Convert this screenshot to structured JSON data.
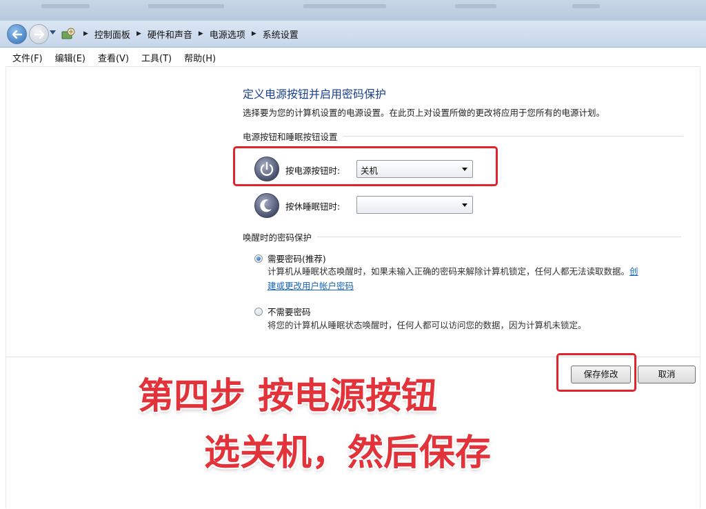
{
  "breadcrumb": [
    "控制面板",
    "硬件和声音",
    "电源选项",
    "系统设置"
  ],
  "menu": [
    "文件(F)",
    "编辑(E)",
    "查看(V)",
    "工具(T)",
    "帮助(H)"
  ],
  "page": {
    "title": "定义电源按钮并启用密码保护",
    "description": "选择要为您的计算机设置的电源设置。在此页上对设置所做的更改将应用于您所有的电源计划。"
  },
  "power_section": {
    "heading": "电源按钮和睡眠按钮设置",
    "power_button_label": "按电源按钮时:",
    "power_button_value": "关机",
    "sleep_button_label": "按休睡眠钮时:",
    "sleep_button_value": ""
  },
  "password_section": {
    "heading": "唤醒时的密码保护",
    "require_label": "需要密码(推荐)",
    "require_selected": true,
    "require_desc_1": "计算机从睡眠状态唤醒时，如果未输入正确的密码来解除计算机锁定，任何人都无法读取数据。",
    "require_link_1": "创",
    "require_link_2": "建或更改用户帐户密码",
    "no_require_label": "不需要密码",
    "no_require_desc": "将您的计算机从睡眠状态唤醒时，任何人都可以访问您的数据，因为计算机未锁定。"
  },
  "buttons": {
    "save": "保存修改",
    "cancel": "取消"
  },
  "overlay": {
    "line1": "第四步 按电源按钮",
    "line2": "选关机，然后保存"
  },
  "icons": {
    "back": "back-arrow-icon",
    "forward": "forward-arrow-icon",
    "control_panel": "control-panel-icon",
    "power": "power-icon",
    "sleep": "moon-icon"
  },
  "colors": {
    "title_blue": "#1a3f8f",
    "link_blue": "#1565c0",
    "annotation_red": "#e0232c"
  }
}
